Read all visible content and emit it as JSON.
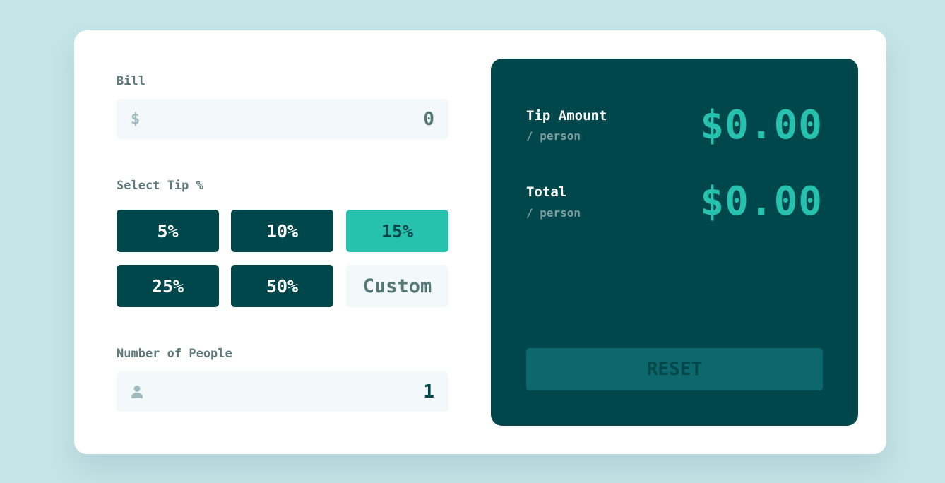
{
  "bill": {
    "label": "Bill",
    "prefix": "$",
    "value": "0"
  },
  "tip": {
    "label": "Select Tip %",
    "options": [
      "5%",
      "10%",
      "15%",
      "25%",
      "50%"
    ],
    "selected": "15%",
    "custom_placeholder": "Custom"
  },
  "people": {
    "label": "Number of People",
    "value": "1",
    "icon": "person-icon"
  },
  "results": {
    "tip_amount": {
      "label": "Tip Amount",
      "sub": "/ person",
      "value": "$0.00"
    },
    "total": {
      "label": "Total",
      "sub": "/ person",
      "value": "$0.00"
    }
  },
  "reset_label": "RESET",
  "colors": {
    "background": "#c5e4e7",
    "dark_cyan": "#00474b",
    "strong_cyan": "#26c2ae",
    "input_bg": "#f3f9fa",
    "reset_disabled": "#0d686d"
  }
}
